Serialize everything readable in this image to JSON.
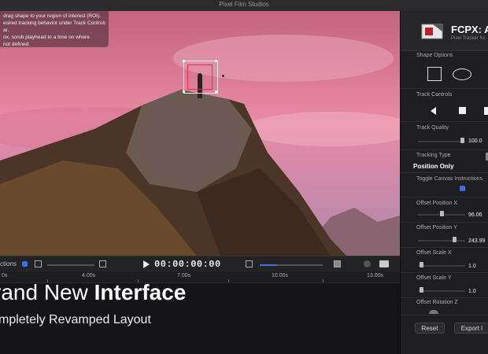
{
  "window": {
    "title": "Pixel Film Studios"
  },
  "instructions": {
    "lines": [
      "drag shape to your region of interest (ROI).",
      "esired tracking behavior under Track Controls",
      "ar.",
      "ox, scrub playhead to a time on where",
      "not defined."
    ]
  },
  "controls": {
    "label": "ctions",
    "timecode": "00:00:00:00"
  },
  "timeline": {
    "ticks": [
      "0s",
      "4.00s",
      "7.00s",
      "10.00s",
      "13.00s"
    ]
  },
  "promo": {
    "headline_pre": "rand New ",
    "headline_bold": "Interface",
    "subline": "mpletely Revamped Layout"
  },
  "panel": {
    "title": "FCPX: Au",
    "subtitle": "Pixel Tracker fro",
    "shape_options": "Shape Options",
    "track_controls": "Track Controls",
    "track_quality": "Track Quality",
    "track_quality_value": "100.0",
    "tracking_type": "Tracking Type",
    "tracking_type_value": "Position Only",
    "toggle_canvas": "Toggle Canvas Instructions",
    "offset_pos_x": "Offset Position X",
    "offset_pos_x_value": "96.06",
    "offset_pos_y": "Offset Position Y",
    "offset_pos_y_value": "243.99",
    "offset_scale_x": "Offset Scale X",
    "offset_scale_x_value": "1.0",
    "offset_scale_y": "Offset Scale Y",
    "offset_scale_y_value": "1.0",
    "offset_rotation_z": "Offset Rotation Z",
    "reset_label": "Reset",
    "export_label": "Export I"
  },
  "colors": {
    "accent": "#3d6fe0",
    "roi": "#e0304a"
  }
}
